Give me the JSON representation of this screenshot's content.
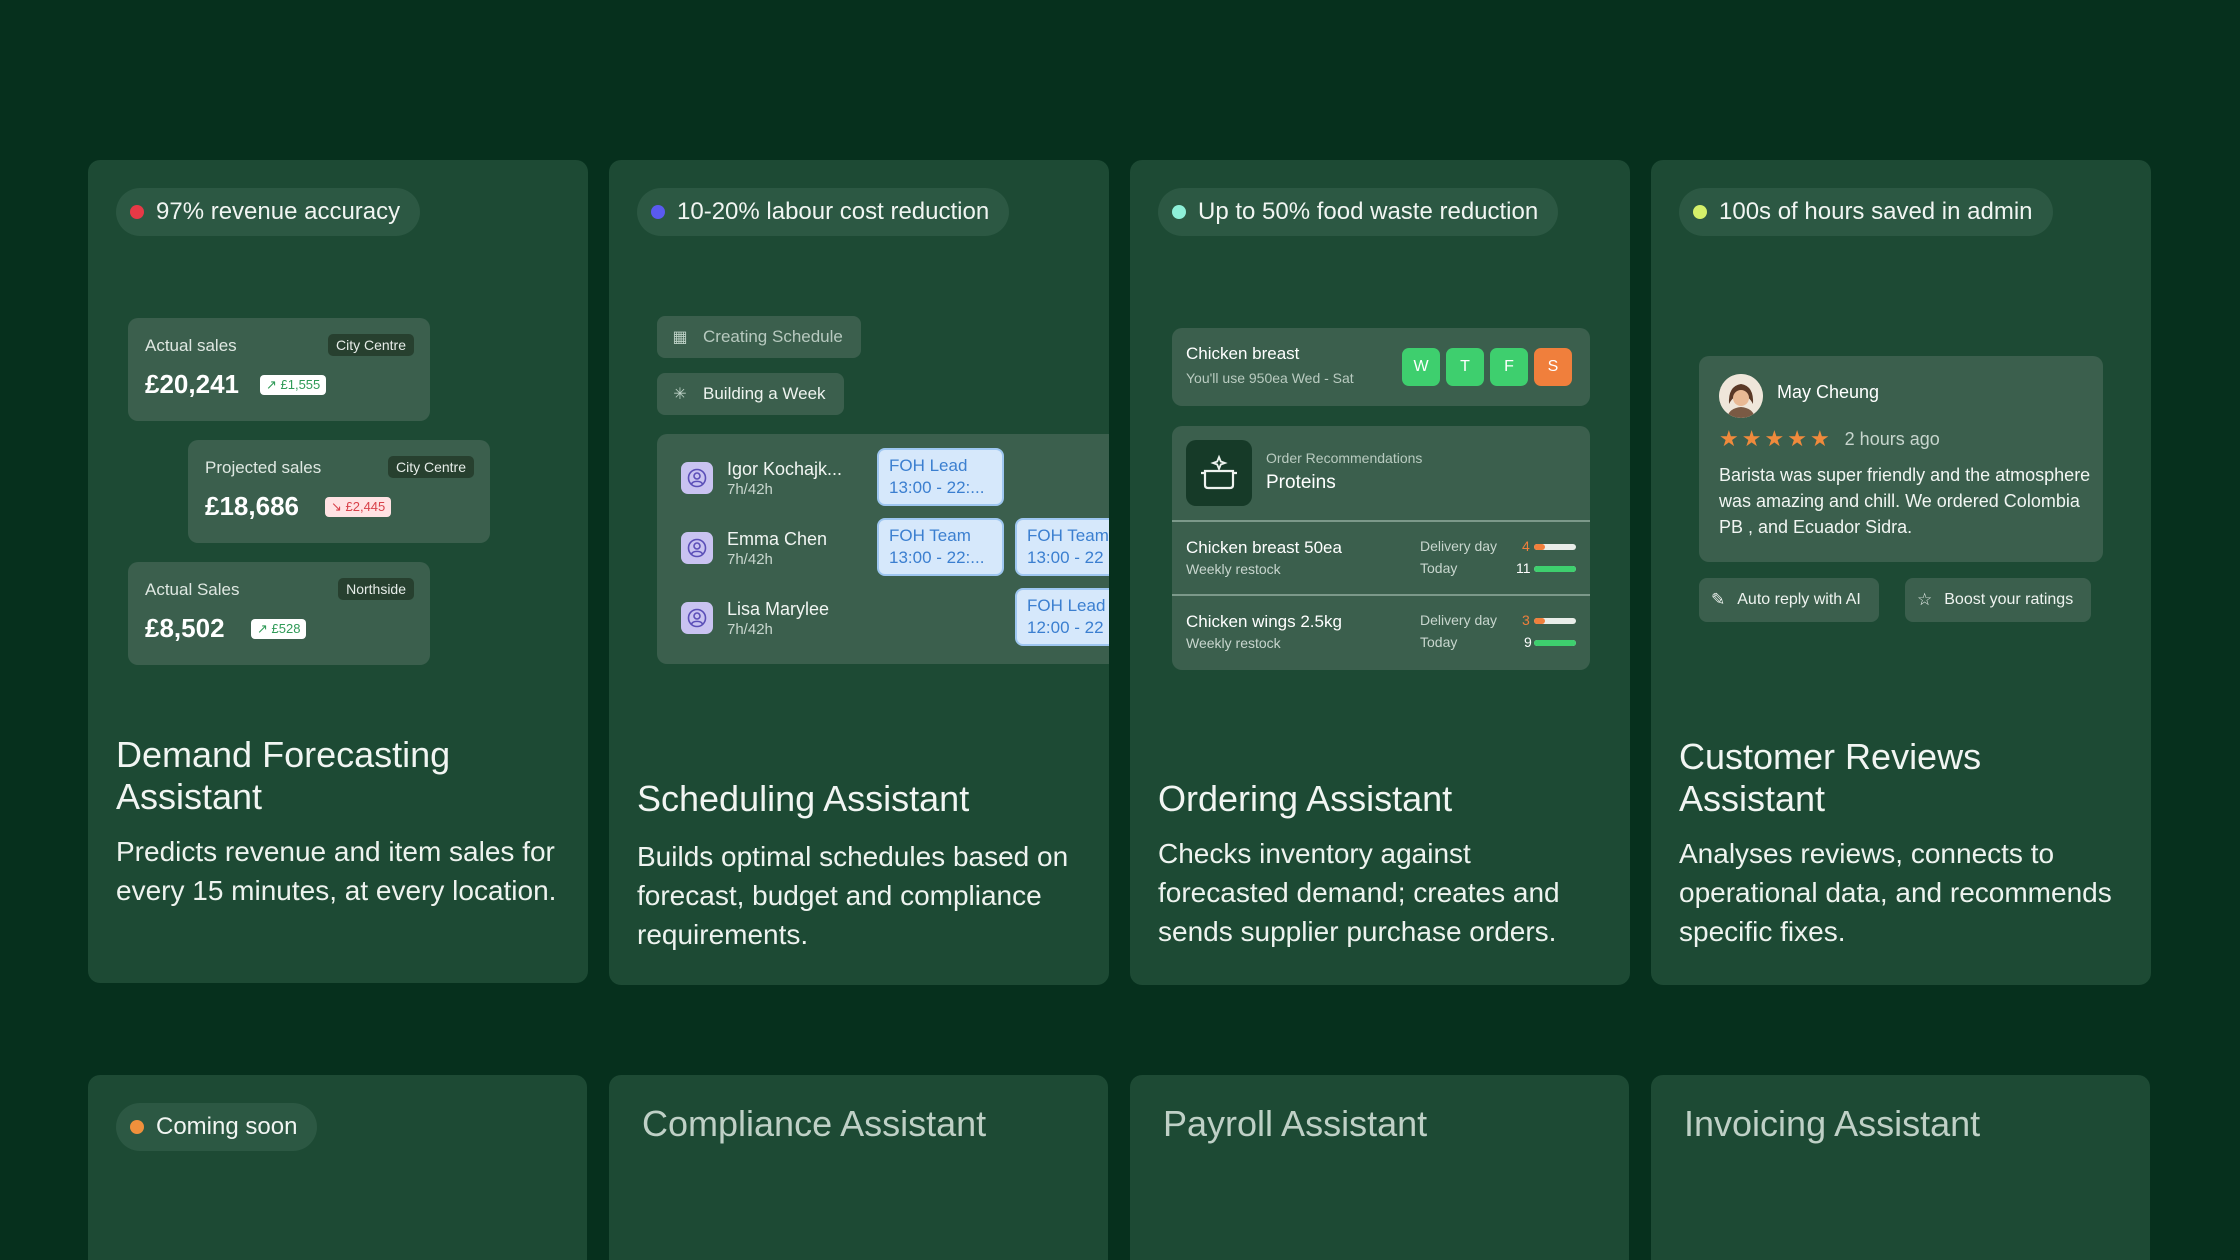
{
  "cards": [
    {
      "pill": "97% revenue accuracy",
      "dot_color": "#e63946",
      "title": "Demand Forecasting Assistant",
      "description": "Predicts revenue and item sales for every 15 minutes, at every location."
    },
    {
      "pill": "10-20% labour cost reduction",
      "dot_color": "#5a5af0",
      "title": "Scheduling Assistant",
      "description": "Builds optimal schedules based on forecast, budget and compliance requirements."
    },
    {
      "pill": "Up to 50% food waste reduction",
      "dot_color": "#8ef0d8",
      "title": "Ordering Assistant",
      "description": "Checks inventory against forecasted demand; creates and sends supplier purchase orders."
    },
    {
      "pill": "100s of hours saved in admin",
      "dot_color": "#d4f06a",
      "title": "Customer Reviews Assistant",
      "description": "Analyses reviews, connects to operational data, and recommends specific fixes."
    }
  ],
  "forecast": [
    {
      "label": "Actual sales",
      "location": "City Centre",
      "value": "£20,241",
      "delta": "↗ £1,555",
      "direction": "up"
    },
    {
      "label": "Projected sales",
      "location": "City Centre",
      "value": "£18,686",
      "delta": "↘ £2,445",
      "direction": "down"
    },
    {
      "label": "Actual Sales",
      "location": "Northside",
      "value": "£8,502",
      "delta": "↗ £528",
      "direction": "up"
    }
  ],
  "scheduling": {
    "steps": [
      "Creating Schedule",
      "Building a Week"
    ],
    "people": [
      {
        "name": "Igor Kochajk...",
        "hours": "7h/42h"
      },
      {
        "name": "Emma Chen",
        "hours": "7h/42h"
      },
      {
        "name": "Lisa Marylee",
        "hours": "7h/42h"
      }
    ],
    "shifts": [
      {
        "role": "FOH Lead",
        "time": "13:00 - 22:..."
      },
      {
        "role": "FOH Team",
        "time": "13:00 - 22:..."
      },
      {
        "role": "FOH Team",
        "time": "13:00 - 22"
      },
      {
        "role": "FOH Lead",
        "time": "12:00 - 22"
      }
    ]
  },
  "ordering": {
    "item": "Chicken breast",
    "usage": "You'll use 950ea Wed - Sat",
    "days": [
      {
        "label": "W",
        "color": "#3ecf6e"
      },
      {
        "label": "T",
        "color": "#3ecf6e"
      },
      {
        "label": "F",
        "color": "#3ecf6e"
      },
      {
        "label": "S",
        "color": "#f07f3c"
      }
    ],
    "rec_label": "Order Recommendations",
    "rec_category": "Proteins",
    "rows": [
      {
        "item": "Chicken breast 50ea",
        "sub": "Weekly restock",
        "k1": "Delivery day",
        "k2": "Today",
        "n1": "4",
        "n2": "11",
        "fill1": 0.25,
        "fill2": 1.0
      },
      {
        "item": "Chicken wings 2.5kg",
        "sub": "Weekly restock",
        "k1": "Delivery day",
        "k2": "Today",
        "n1": "3",
        "n2": "9",
        "fill1": 0.25,
        "fill2": 1.0
      }
    ]
  },
  "review": {
    "name": "May Cheung",
    "rating": 5,
    "time": "2 hours ago",
    "text": "Barista was super friendly and the atmosphere was amazing and chill. We ordered Colombia PB , and Ecuador Sidra.",
    "actions": [
      "Auto reply with AI",
      "Boost your ratings"
    ]
  },
  "bottom": {
    "pill": "Coming soon",
    "dot_color": "#f0903c",
    "titles": [
      "Compliance Assistant",
      "Payroll Assistant",
      "Invoicing Assistant"
    ]
  }
}
